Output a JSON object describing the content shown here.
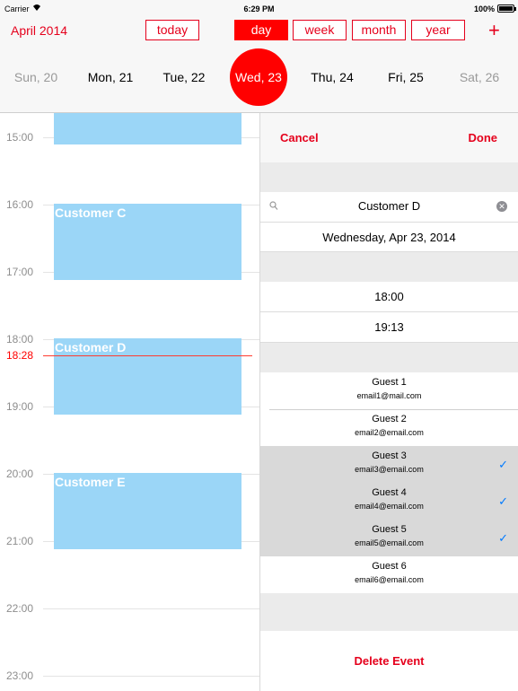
{
  "status_bar": {
    "carrier": "Carrier",
    "time": "6:29 PM",
    "battery": "100%"
  },
  "toolbar": {
    "month": "April 2014",
    "views": [
      "today",
      "day",
      "week",
      "month",
      "year"
    ],
    "active_view": "day",
    "add": "+"
  },
  "days": [
    "Sun, 20",
    "Mon, 21",
    "Tue, 22",
    "Wed, 23",
    "Thu, 24",
    "Fri, 25",
    "Sat, 26"
  ],
  "selected_day": "Wed, 23",
  "timeline": {
    "hours": [
      "15:00",
      "16:00",
      "17:00",
      "18:00",
      "19:00",
      "20:00",
      "21:00",
      "22:00",
      "23:00"
    ],
    "current_time": "18:28",
    "events": [
      "Customer C",
      "Customer D",
      "Customer E"
    ]
  },
  "editor": {
    "cancel": "Cancel",
    "done": "Done",
    "search_value": "Customer D",
    "date": "Wednesday, Apr 23, 2014",
    "start_time": "18:00",
    "end_time": "19:13",
    "guests": [
      {
        "name": "Guest 1",
        "email": "email1@mail.com",
        "selected": false
      },
      {
        "name": "Guest 2",
        "email": "email2@email.com",
        "selected": false
      },
      {
        "name": "Guest 3",
        "email": "email3@email.com",
        "selected": true
      },
      {
        "name": "Guest 4",
        "email": "email4@email.com",
        "selected": true
      },
      {
        "name": "Guest 5",
        "email": "email5@email.com",
        "selected": true
      },
      {
        "name": "Guest 6",
        "email": "email6@email.com",
        "selected": false
      }
    ],
    "check_mark": "✓",
    "delete": "Delete Event"
  },
  "colors": {
    "accent": "#e5001c",
    "event": "#9bd6f7",
    "check": "#007aff",
    "selected_row": "#d9d9d9"
  }
}
